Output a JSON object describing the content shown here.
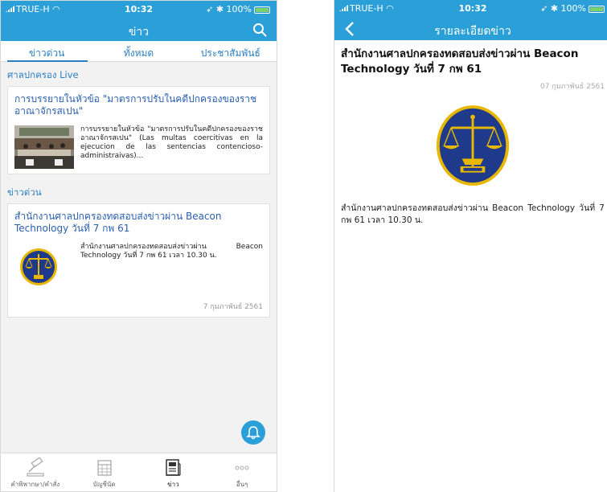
{
  "status_bar": {
    "carrier": "TRUE-H",
    "time": "10:32",
    "battery": "100%"
  },
  "list_screen": {
    "title": "ข่าว",
    "tabs": [
      "ข่าวด่วน",
      "ทั้งหมด",
      "ประชาสัมพันธ์"
    ],
    "active_tab": 0,
    "live_section": {
      "header": "ศาลปกครอง Live",
      "card_title": "การบรรยายในหัวข้อ \"มาตรการปรับในคดีปกครองของราชอาณาจักรสเปน\"",
      "card_text": "การบรรยายในหัวข้อ \"มาตรการปรับในคดีปกครองของราชอาณาจักรสเปน\" (Las multas coercitivas en la ejecucion de las sentencias contencioso-administraivas)..."
    },
    "news_section": {
      "header": "ข่าวด่วน",
      "card_title": "สำนักงานศาลปกครองทดสอบส่งข่าวผ่าน Beacon Technology วันที่ 7 กพ 61",
      "card_text": "สำนักงานศาลปกครองทดสอบส่งข่าวผ่าน Beacon Technology วันที่ 7 กพ 61 เวลา 10.30 น.",
      "card_date": "7 กุมภาพันธ์ 2561"
    },
    "tabbar": [
      {
        "label": "คำพิพากษา/คำสั่ง",
        "icon": "gavel-icon"
      },
      {
        "label": "บัญชีนัด",
        "icon": "calendar-icon"
      },
      {
        "label": "ข่าว",
        "icon": "news-icon"
      },
      {
        "label": "อื่นๆ",
        "icon": "more-icon"
      }
    ],
    "active_tabbar": 2
  },
  "detail_screen": {
    "title": "รายละเอียดข่าว",
    "headline": "สำนักงานศาลปกครองทดสอบส่งข่าวผ่าน Beacon Technology วันที่ 7 กพ 61",
    "date": "07 กุมภาพันธ์ 2561",
    "body": "สำนักงานศาลปกครองทดสอบส่งข่าวผ่าน Beacon Technology วันที่ 7 กพ 61 เวลา 10.30 น."
  },
  "colors": {
    "primary": "#2a9fd8",
    "link": "#2a7fc0",
    "seal_blue": "#1f3a8a",
    "seal_gold": "#e8b800"
  }
}
